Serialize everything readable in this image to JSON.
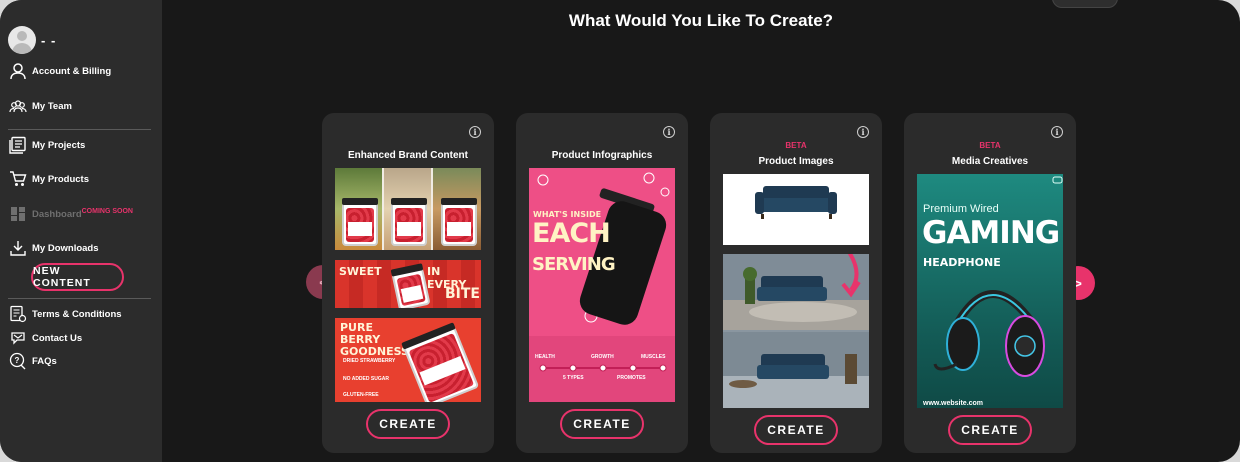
{
  "sidebar": {
    "brand_fragment": "",
    "user_name": "- -",
    "items": [
      {
        "label": "Account & Billing",
        "icon": "user-icon"
      },
      {
        "label": "My Team",
        "icon": "team-icon"
      },
      {
        "label": "My Projects",
        "icon": "projects-icon"
      },
      {
        "label": "My Products",
        "icon": "cart-icon"
      },
      {
        "label": "Dashboard",
        "icon": "dashboard-icon",
        "badge": "COMING SOON"
      },
      {
        "label": "My Downloads",
        "icon": "download-icon"
      }
    ],
    "new_content_label": "NEW CONTENT",
    "footer_items": [
      {
        "label": "Terms & Conditions",
        "icon": "terms-icon"
      },
      {
        "label": "Contact Us",
        "icon": "contact-icon"
      },
      {
        "label": "FAQs",
        "icon": "faq-icon"
      }
    ]
  },
  "main": {
    "title": "What Would You Like To Create?",
    "prev_arrow": "<",
    "next_arrow": ">",
    "info_glyph": "i",
    "cards": [
      {
        "title": "Enhanced Brand Content",
        "beta": "",
        "create_label": "CREATE",
        "banner_text": "SWEET",
        "banner_text_2": "IN EVERY",
        "banner_text_3": "BITE",
        "promo_title": "PURE BERRY GOODNESS",
        "promo_lines": [
          "DRIED STRAWBERRY",
          "NO ADDED SUGAR",
          "GLUTEN-FREE"
        ]
      },
      {
        "title": "Product Infographics",
        "beta": "",
        "create_label": "CREATE",
        "headline_1": "WHAT'S INSIDE",
        "headline_2": "EACH",
        "headline_3": "SERVING",
        "stats": [
          "HEALTH",
          "GROWTH",
          "MUSCLES"
        ],
        "stats_2": [
          "5 TYPES",
          "PROMOTES"
        ]
      },
      {
        "title": "Product Images",
        "beta": "BETA",
        "create_label": "CREATE"
      },
      {
        "title": "Media Creatives",
        "beta": "BETA",
        "create_label": "CREATE",
        "ad_line_1": "Premium Wired",
        "ad_line_2": "GAMING",
        "ad_line_3": "HEADPHONE",
        "ad_url": "www.website.com"
      }
    ]
  },
  "colors": {
    "accent": "#e8336b",
    "sidebar_bg": "#2c2c2c",
    "main_bg": "#181818",
    "card_bg": "#2b2b2b"
  }
}
